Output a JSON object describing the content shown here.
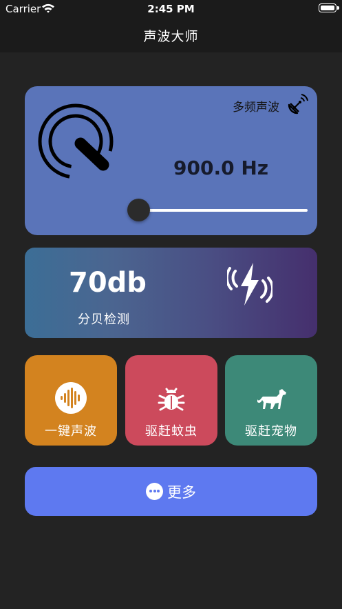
{
  "status_bar": {
    "carrier": "Carrier",
    "time": "2:45 PM"
  },
  "nav": {
    "title": "声波大师"
  },
  "frequency_card": {
    "multi_label": "多频声波",
    "frequency": "900.0 Hz",
    "slider_position": 0.05,
    "color": "#5a74b9"
  },
  "decibel_card": {
    "value": "70db",
    "label": "分贝检测"
  },
  "tiles": [
    {
      "label": "一键声波",
      "icon": "sound-wave-icon",
      "color": "#d3831f"
    },
    {
      "label": "驱赶蚊虫",
      "icon": "bug-icon",
      "color": "#cc4a5c"
    },
    {
      "label": "驱赶宠物",
      "icon": "dog-icon",
      "color": "#3d8978"
    }
  ],
  "more_button": {
    "label": "更多",
    "icon": "more-dots-icon",
    "color": "#5e79f0"
  }
}
